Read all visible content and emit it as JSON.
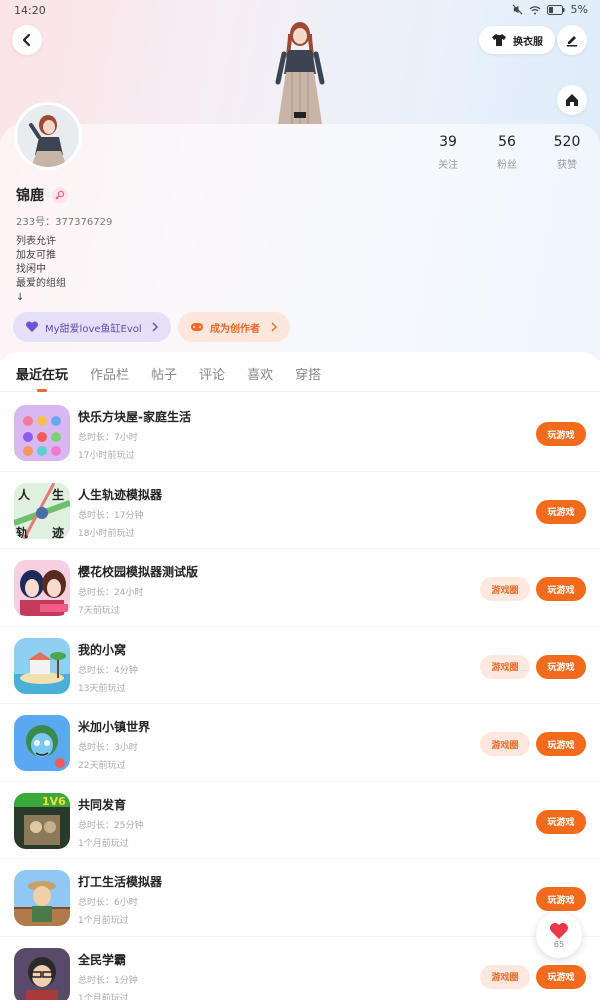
{
  "status": {
    "time": "14:20",
    "battery": "5%"
  },
  "header": {
    "wardrobe_label": "换衣服"
  },
  "profile": {
    "name": "锦鹿",
    "uid": "233号：377376729",
    "bio": "列表允许\n加友可推\n找闲中\n最爱的组组\n↓",
    "stats": [
      {
        "num": "39",
        "label": "关注"
      },
      {
        "num": "56",
        "label": "粉丝"
      },
      {
        "num": "520",
        "label": "获赞"
      }
    ],
    "tag_fan": "My甜爱love鱼缸Evol",
    "tag_creator": "成为创作者"
  },
  "tabs": [
    "最近在玩",
    "作品栏",
    "帖子",
    "评论",
    "喜欢",
    "穿搭"
  ],
  "games": [
    {
      "name": "快乐方块屋-家庭生活",
      "duration": "总时长：7小时",
      "last": "17小时前玩过",
      "circle": false,
      "play": "玩游戏"
    },
    {
      "name": "人生轨迹模拟器",
      "duration": "总时长：17分钟",
      "last": "18小时前玩过",
      "circle": false,
      "play": "玩游戏"
    },
    {
      "name": "樱花校园模拟器测试版",
      "duration": "总时长：24小时",
      "last": "7天前玩过",
      "circle": true,
      "circle_label": "游戏圈",
      "play": "玩游戏"
    },
    {
      "name": "我的小窝",
      "duration": "总时长：4分钟",
      "last": "13天前玩过",
      "circle": true,
      "circle_label": "游戏圈",
      "play": "玩游戏"
    },
    {
      "name": "米加小镇世界",
      "duration": "总时长：3小时",
      "last": "22天前玩过",
      "circle": true,
      "circle_label": "游戏圈",
      "play": "玩游戏"
    },
    {
      "name": "共同发育",
      "duration": "总时长：25分钟",
      "last": "1个月前玩过",
      "circle": false,
      "play": "玩游戏"
    },
    {
      "name": "打工生活模拟器",
      "duration": "总时长：6小时",
      "last": "1个月前玩过",
      "circle": false,
      "play": "玩游戏"
    },
    {
      "name": "全民学霸",
      "duration": "总时长：1分钟",
      "last": "1个月前玩过",
      "circle": true,
      "circle_label": "游戏圈",
      "play": "玩游戏"
    }
  ],
  "float_like": {
    "count": "65"
  },
  "colors": {
    "accent": "#f26b1d",
    "tag_fan_bg": "#e5e0f8",
    "tag_creator_bg": "#fde7dc"
  }
}
